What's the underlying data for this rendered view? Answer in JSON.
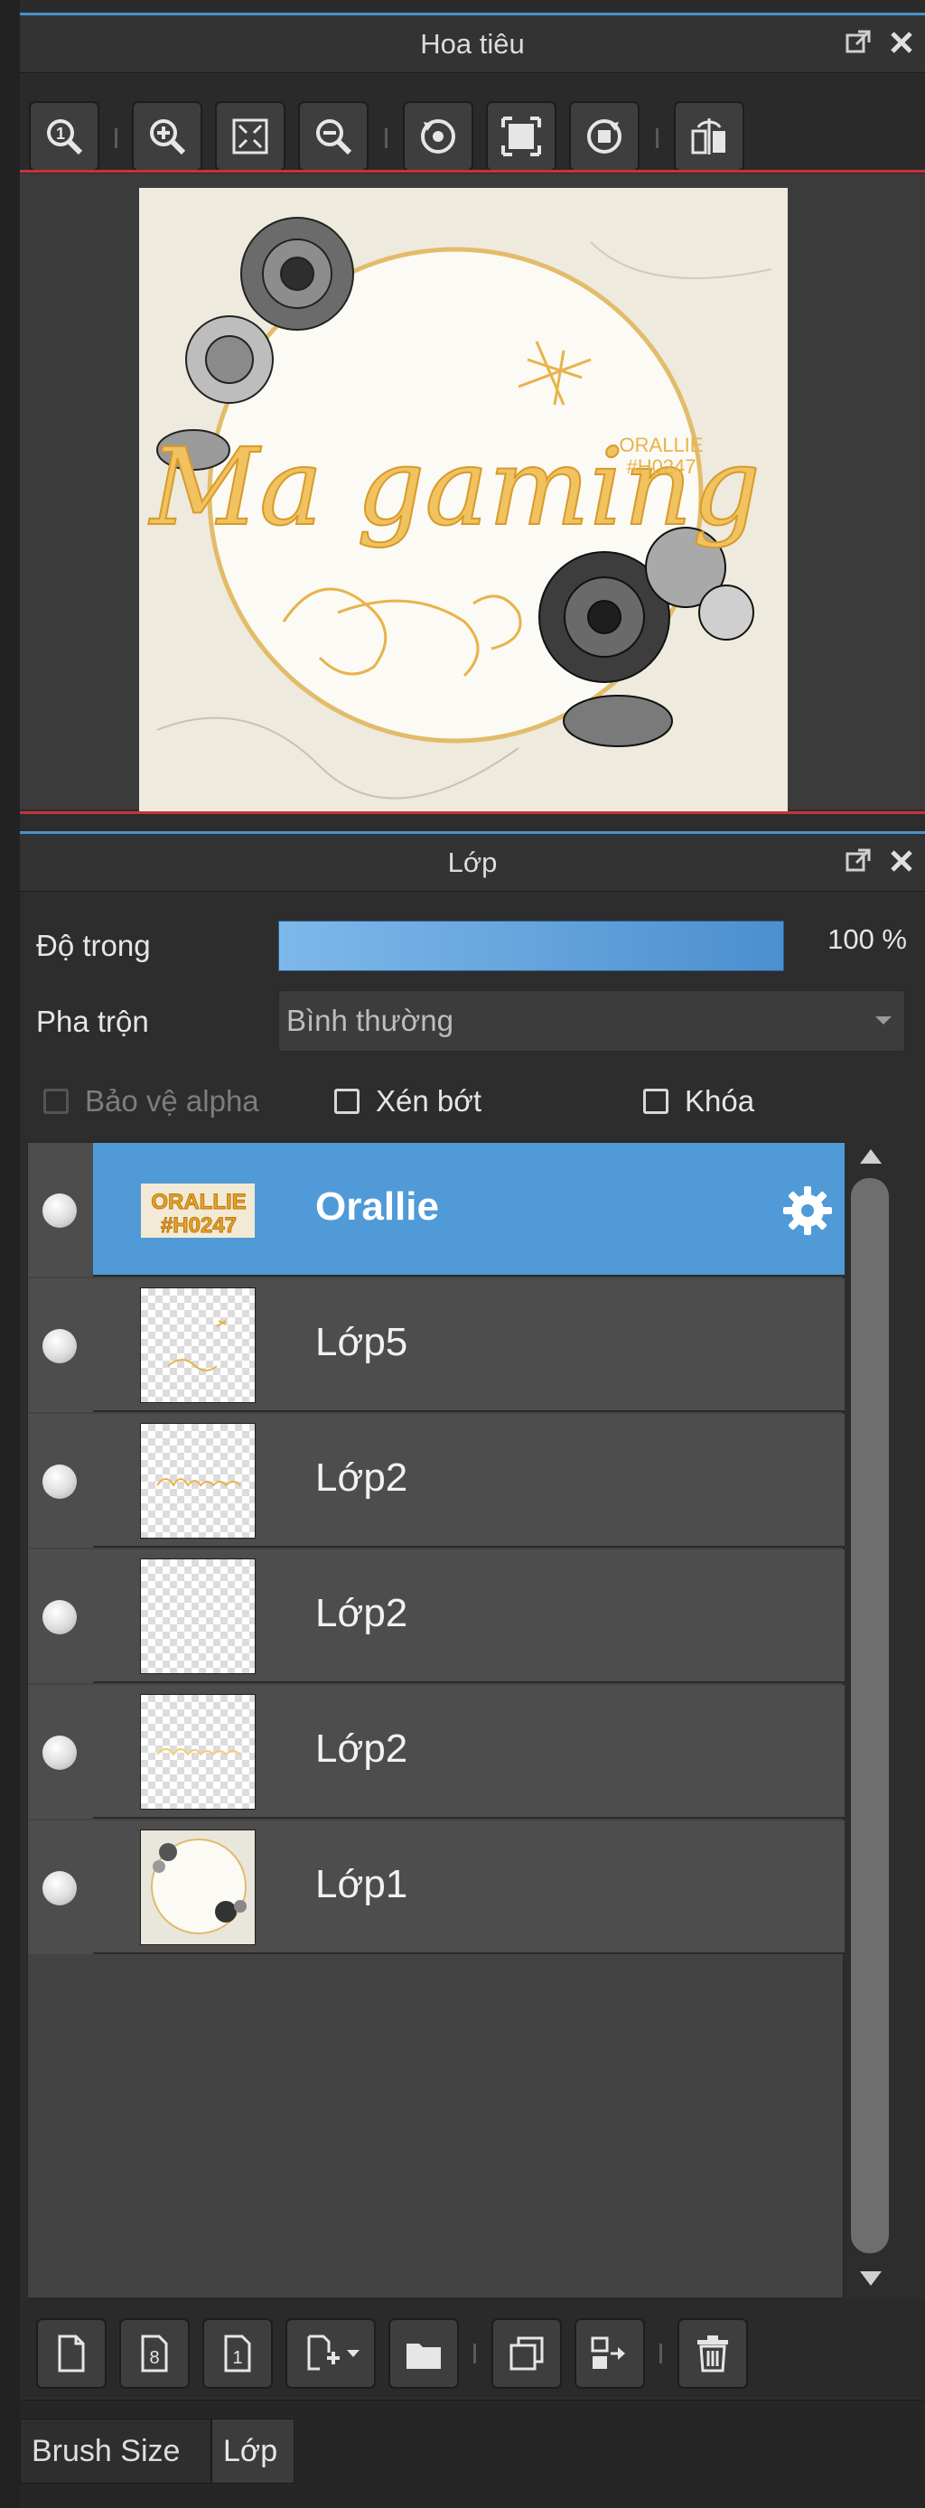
{
  "navigator": {
    "title": "Hoa tiêu",
    "toolbar_icons": [
      "zoom-actual-icon",
      "zoom-in-icon",
      "fit-screen-icon",
      "zoom-out-icon",
      "rotate-left-icon",
      "reset-view-icon",
      "rotate-right-icon",
      "flip-horizontal-icon"
    ],
    "preview": {
      "logo_text": "Ma gaming",
      "badge_line1": "ORALLIE",
      "badge_line2": "#H0247"
    }
  },
  "layers_panel": {
    "title": "Lớp",
    "opacity_label": "Độ trong",
    "opacity_value": "100 %",
    "opacity_fraction": 1.0,
    "blend_label": "Pha trộn",
    "blend_value": "Bình thường",
    "checks": {
      "protect_alpha": "Bảo vệ alpha",
      "clipping": "Xén bớt",
      "lock": "Khóa"
    },
    "layers": [
      {
        "name": "Orallie",
        "selected": true,
        "thumb_text": "ORALLIE #H0247"
      },
      {
        "name": "Lớp5",
        "selected": false
      },
      {
        "name": "Lớp2",
        "selected": false
      },
      {
        "name": "Lớp2",
        "selected": false
      },
      {
        "name": "Lớp2",
        "selected": false
      },
      {
        "name": "Lớp1",
        "selected": false
      }
    ],
    "bottom_icons": [
      "new-layer-icon",
      "new-8bit-layer-icon",
      "new-1bit-layer-icon",
      "add-layer-menu-icon",
      "new-folder-icon",
      "duplicate-layer-icon",
      "merge-down-icon",
      "delete-layer-icon"
    ]
  },
  "dock_tabs": [
    "Brush Size",
    "Lớp"
  ],
  "colors": {
    "accent": "#4f9ad7",
    "panel_bg": "#2d2d2d",
    "row_bg": "#4d4d4d",
    "gold": "#e8b34a"
  }
}
